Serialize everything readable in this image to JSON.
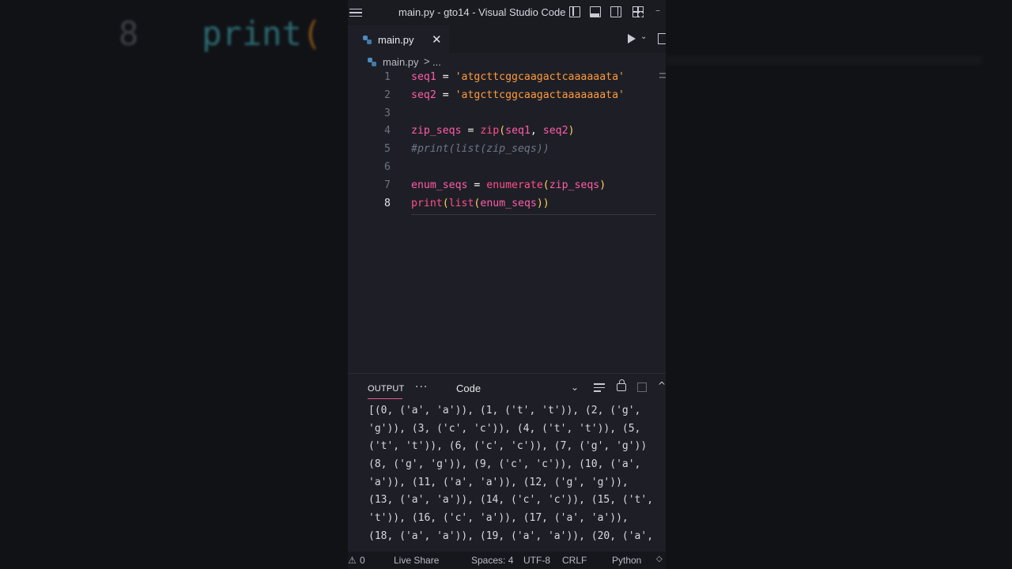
{
  "backdrop": {
    "line_number": "8",
    "keyword": "print",
    "paren": "("
  },
  "window": {
    "title": "main.py - gto14 - Visual Studio Code"
  },
  "titlebar": {
    "menu_icon": "hamburger-menu-icon",
    "layout_icons": [
      "toggle-primary-sidebar-icon",
      "toggle-panel-icon",
      "toggle-secondary-sidebar-icon",
      "customize-layout-icon"
    ],
    "minimize": "–"
  },
  "tabs": [
    {
      "label": "main.py",
      "icon": "python-file-icon",
      "close": "✕"
    }
  ],
  "editor_actions": {
    "run_icon": "run-python-file-icon",
    "dropdown": "⌄"
  },
  "breadcrumb": {
    "file": "main.py",
    "separator": ">",
    "ellipsis": "..."
  },
  "editor": {
    "active_line": 8,
    "lines": [
      {
        "n": "1",
        "parts": [
          [
            "v",
            "seq1"
          ],
          [
            "op",
            " = "
          ],
          [
            "str",
            "'atgcttcggcaagactcaaaaaata'"
          ]
        ]
      },
      {
        "n": "2",
        "parts": [
          [
            "v",
            "seq2"
          ],
          [
            "op",
            " = "
          ],
          [
            "str",
            "'atgcttcggcaagactaaaaaaata'"
          ]
        ]
      },
      {
        "n": "3",
        "parts": []
      },
      {
        "n": "4",
        "parts": [
          [
            "v",
            "zip_seqs"
          ],
          [
            "op",
            " = "
          ],
          [
            "fn",
            "zip"
          ],
          [
            "par",
            "("
          ],
          [
            "v",
            "seq1"
          ],
          [
            "op",
            ", "
          ],
          [
            "v",
            "seq2"
          ],
          [
            "par",
            ")"
          ]
        ]
      },
      {
        "n": "5",
        "parts": [
          [
            "cm",
            "#print(list(zip_seqs))"
          ]
        ]
      },
      {
        "n": "6",
        "parts": []
      },
      {
        "n": "7",
        "parts": [
          [
            "v",
            "enum_seqs"
          ],
          [
            "op",
            " = "
          ],
          [
            "fn",
            "enumerate"
          ],
          [
            "par",
            "("
          ],
          [
            "v",
            "zip_seqs"
          ],
          [
            "par",
            ")"
          ]
        ]
      },
      {
        "n": "8",
        "parts": [
          [
            "fn",
            "print"
          ],
          [
            "par",
            "("
          ],
          [
            "fn",
            "list"
          ],
          [
            "par",
            "("
          ],
          [
            "v",
            "enum_seqs"
          ],
          [
            "par",
            "))"
          ]
        ]
      }
    ]
  },
  "panel": {
    "tab_label": "OUTPUT",
    "more": "···",
    "channel": "Code",
    "chevron": "⌄",
    "actions": [
      "clear-output-icon",
      "lock-scroll-icon",
      "copy-icon",
      "maximize-panel-icon"
    ],
    "up": "^",
    "output_lines": [
      "[(0, ('a', 'a')), (1, ('t', 't')), (2, ('g',",
      "'g')), (3, ('c', 'c')), (4, ('t', 't')), (5,",
      "('t', 't')), (6, ('c', 'c')), (7, ('g', 'g'))",
      "(8, ('g', 'g')), (9, ('c', 'c')), (10, ('a',",
      "'a')), (11, ('a', 'a')), (12, ('g', 'g')),",
      "(13, ('a', 'a')), (14, ('c', 'c')), (15, ('t',",
      "'t')), (16, ('c', 'a')), (17, ('a', 'a')),",
      "(18, ('a', 'a')), (19, ('a', 'a')), (20, ('a',"
    ]
  },
  "statusbar": {
    "warnings_icon": "⚠",
    "warnings": "0",
    "live_share": "Live Share",
    "spaces": "Spaces: 4",
    "encoding": "UTF-8",
    "eol": "CRLF",
    "language": "Python",
    "bell": "🔔"
  },
  "colors": {
    "variable": "#ff5ca8",
    "string": "#ff9a3c",
    "function": "#ff4f8b",
    "paren": "#ffd35c",
    "comment": "#6f7488",
    "background": "#1e1f26",
    "accent": "#e65a8e"
  }
}
